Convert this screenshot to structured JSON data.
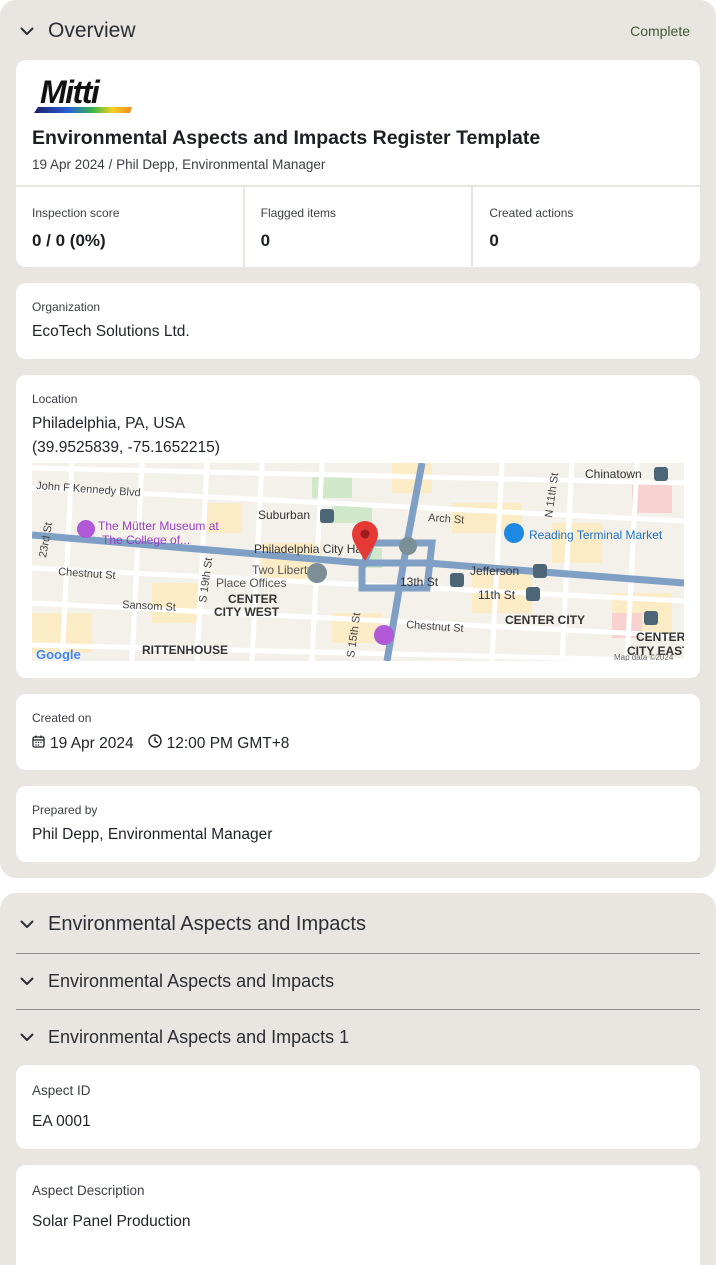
{
  "overview": {
    "title": "Overview",
    "status": "Complete",
    "logo_text": "Mitti",
    "doc_title": "Environmental Aspects and Impacts Register Template",
    "doc_subtitle": "19 Apr 2024 / Phil Depp, Environmental Manager",
    "stats": [
      {
        "label": "Inspection score",
        "value": "0 / 0 (0%)"
      },
      {
        "label": "Flagged items",
        "value": "0"
      },
      {
        "label": "Created actions",
        "value": "0"
      }
    ],
    "organization": {
      "label": "Organization",
      "value": "EcoTech Solutions Ltd."
    },
    "location": {
      "label": "Location",
      "address": "Philadelphia, PA, USA",
      "coords": "(39.9525839, -75.1652215)",
      "map": {
        "streets": [
          "John F Kennedy Blvd",
          "Chestnut St",
          "Sansom St",
          "Arch St",
          "Chestnut St",
          "23rd St",
          "S 19th St",
          "S 15th St",
          "N 11th St"
        ],
        "places": [
          "Suburban",
          "Chinatown",
          "Philadelphia City Hall",
          "Two Liberty Place Offices",
          "Reading Terminal Market",
          "Jefferson",
          "13th St",
          "11th St",
          "CENTER CITY WEST",
          "CENTER CITY",
          "CENTER CITY EAST",
          "RITTENHOUSE SQUARE",
          "The Mütter Museum at The College of..."
        ],
        "attribution": "Google",
        "copyright": "Map data ©2024"
      }
    },
    "created_on": {
      "label": "Created on",
      "date": "19 Apr 2024",
      "time": "12:00 PM GMT+8"
    },
    "prepared_by": {
      "label": "Prepared by",
      "value": "Phil Depp, Environmental Manager"
    }
  },
  "aspects": {
    "title": "Environmental Aspects and Impacts",
    "sub_section_1": "Environmental Aspects and Impacts",
    "sub_section_2": "Environmental Aspects and Impacts 1",
    "fields": [
      {
        "label": "Aspect ID",
        "value": "EA 0001"
      },
      {
        "label": "Aspect Description",
        "value": "Solar Panel Production"
      }
    ]
  },
  "colors": {
    "section_bg": "#e9e6e1",
    "status_green": "#3d5b2f",
    "map_pin": "#e53935"
  }
}
